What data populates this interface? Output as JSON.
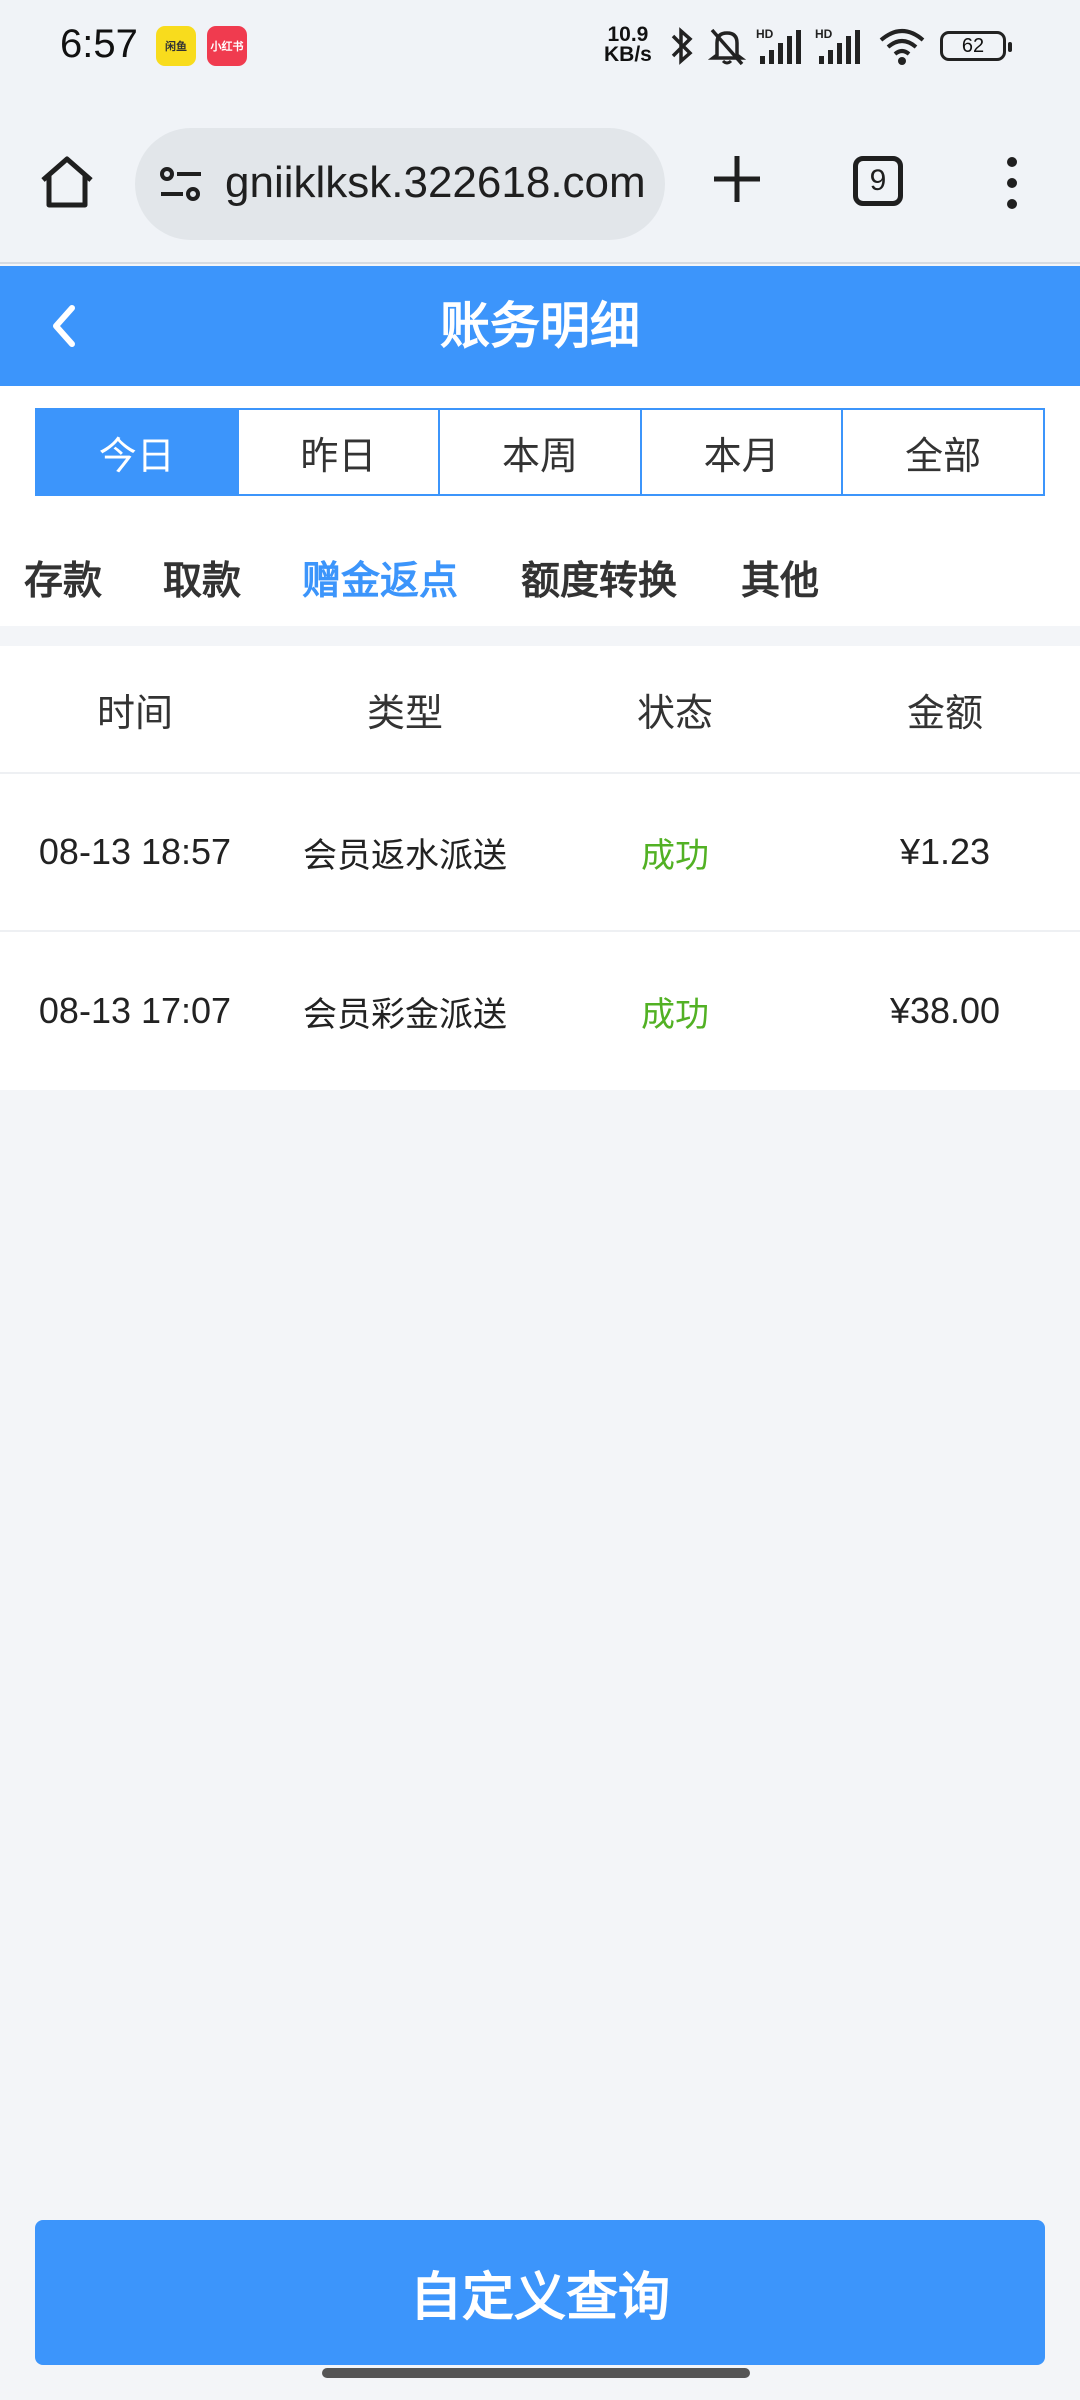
{
  "status_bar": {
    "time": "6:57",
    "apps": [
      "闲鱼",
      "小红书"
    ],
    "net_speed_value": "10.9",
    "net_speed_unit": "KB/s",
    "battery": "62"
  },
  "browser": {
    "url": "gniiklksk.322618.com",
    "tab_count": "9"
  },
  "header": {
    "title": "账务明细"
  },
  "date_filter": {
    "tabs": [
      "今日",
      "昨日",
      "本周",
      "本月",
      "全部"
    ],
    "active_index": 0
  },
  "category_tabs": {
    "items": [
      "存款",
      "取款",
      "赠金返点",
      "额度转换",
      "其他"
    ],
    "active_index": 2
  },
  "table": {
    "headers": [
      "时间",
      "类型",
      "状态",
      "金额"
    ],
    "rows": [
      {
        "time": "08-13 18:57",
        "type": "会员返水派送",
        "status": "成功",
        "amount": "¥1.23"
      },
      {
        "time": "08-13 17:07",
        "type": "会员彩金派送",
        "status": "成功",
        "amount": "¥38.00"
      }
    ]
  },
  "footer": {
    "query_button": "自定义查询"
  },
  "colors": {
    "accent": "#3c95fb",
    "success": "#52b124",
    "background": "#f3f5f8"
  }
}
